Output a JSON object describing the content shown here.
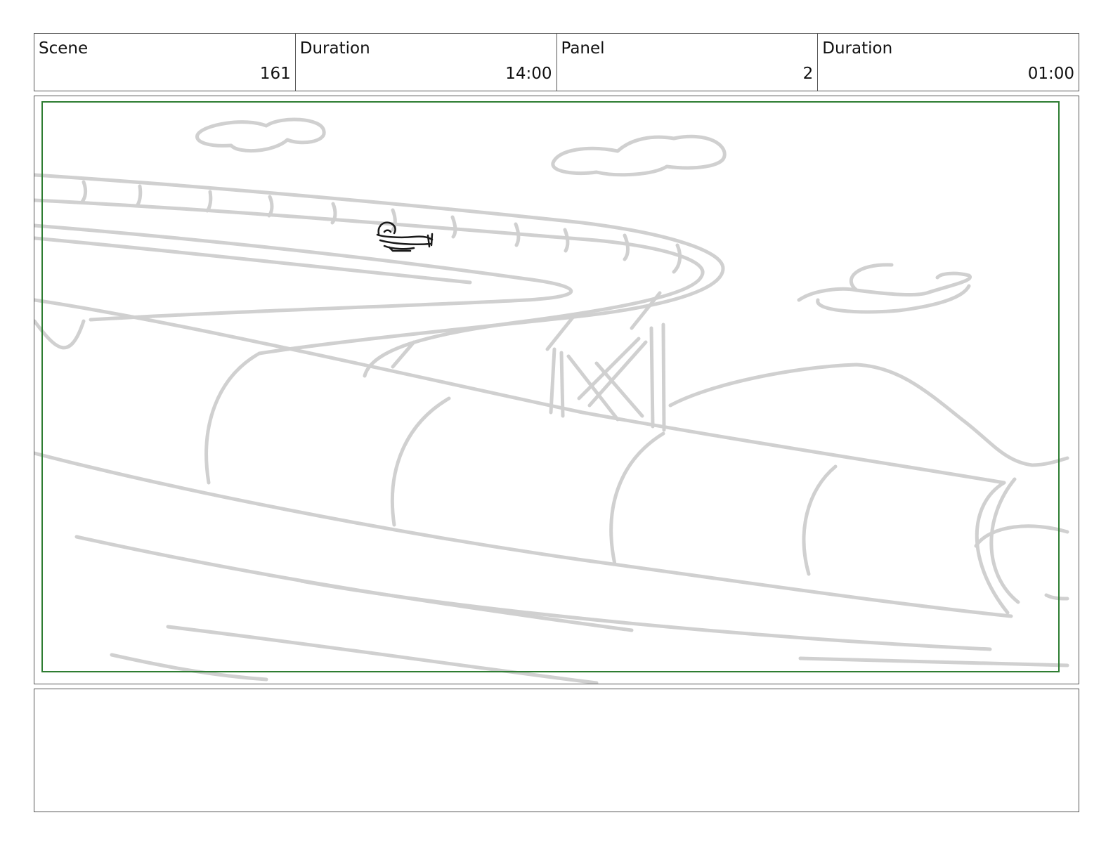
{
  "header": {
    "scene_label": "Scene",
    "scene_value": "161",
    "scene_duration_label": "Duration",
    "scene_duration_value": "14:00",
    "panel_label": "Panel",
    "panel_value": "2",
    "panel_duration_label": "Duration",
    "panel_duration_value": "01:00"
  },
  "colors": {
    "border": "#555555",
    "safe_frame": "#2e7d32",
    "sketch": "#d0d0d0",
    "character_ink": "#1a1a1a"
  },
  "notes": {
    "text": ""
  }
}
